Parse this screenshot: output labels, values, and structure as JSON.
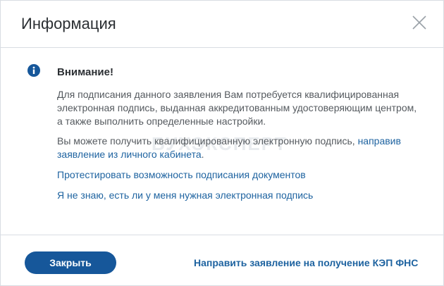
{
  "dialog": {
    "title": "Информация"
  },
  "notice": {
    "heading": "Внимание!",
    "paragraph1": "Для подписания данного заявления Вам потребуется квалифицированная электронная подпись, выданная аккредитованным удостоверяющим центром, а также выполнить определенные настройки.",
    "paragraph2_text": "Вы можете получить квалифицированную электронную подпись, ",
    "paragraph2_link": "направив заявление из личного кабинета",
    "paragraph2_end": ".",
    "link_test": "Протестировать возможность подписания документов",
    "link_check": "Я не знаю, есть ли у меня нужная электронная подпись",
    "watermark": "БУХЭКСПЕРТ"
  },
  "footer": {
    "close_label": "Закрыть",
    "send_link": "Направить заявление на получение КЭП ФНС"
  },
  "colors": {
    "accent": "#16579a",
    "link": "#1e63a0",
    "text": "#555a5f"
  }
}
